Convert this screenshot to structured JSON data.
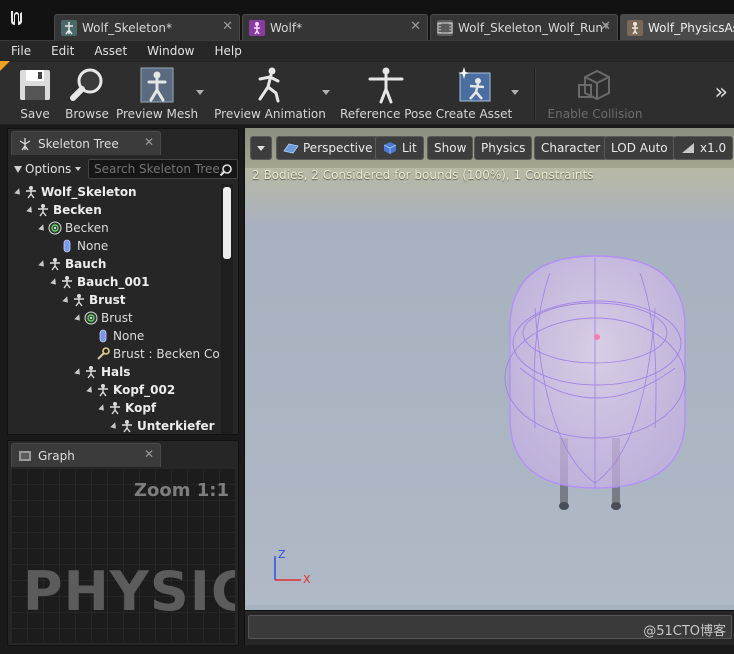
{
  "doc_tabs": [
    {
      "label": "Wolf_Skeleton*",
      "icon": "skeleton-asset-icon",
      "color": "#4a6a6a"
    },
    {
      "label": "Wolf*",
      "icon": "skeletal-mesh-icon",
      "color": "#8a3aa0"
    },
    {
      "label": "Wolf_Skeleton_Wolf_Run*",
      "icon": "animation-sequence-icon",
      "color": "#7a7a7a"
    },
    {
      "label": "Wolf_PhysicsAs",
      "icon": "physics-asset-icon",
      "color": "#7a6a5a"
    }
  ],
  "menu": [
    "File",
    "Edit",
    "Asset",
    "Window",
    "Help"
  ],
  "toolbar": {
    "save": "Save",
    "browse": "Browse",
    "preview_mesh": "Preview Mesh",
    "preview_animation": "Preview Animation",
    "reference_pose": "Reference Pose",
    "create_asset": "Create Asset",
    "enable_collision": "Enable Collision",
    "more": "»"
  },
  "skeleton_panel": {
    "tab": "Skeleton Tree",
    "options": "Options",
    "search_placeholder": "Search Skeleton Tree..."
  },
  "tree": [
    {
      "label": "Wolf_Skeleton",
      "type": "bone",
      "depth": 0,
      "bold": true
    },
    {
      "label": "Becken",
      "type": "bone",
      "depth": 1,
      "bold": true
    },
    {
      "label": "Becken",
      "type": "body",
      "depth": 2,
      "bold": false
    },
    {
      "label": "None",
      "type": "shape",
      "depth": 3,
      "bold": false
    },
    {
      "label": "Bauch",
      "type": "bone",
      "depth": 2,
      "bold": true
    },
    {
      "label": "Bauch_001",
      "type": "bone",
      "depth": 3,
      "bold": true
    },
    {
      "label": "Brust",
      "type": "bone",
      "depth": 4,
      "bold": true
    },
    {
      "label": "Brust",
      "type": "body",
      "depth": 5,
      "bold": false
    },
    {
      "label": "None",
      "type": "shape",
      "depth": 6,
      "bold": false
    },
    {
      "label": "Brust : Becken Cons",
      "type": "constraint",
      "depth": 6,
      "bold": false
    },
    {
      "label": "Hals",
      "type": "bone",
      "depth": 5,
      "bold": true
    },
    {
      "label": "Kopf_002",
      "type": "bone",
      "depth": 6,
      "bold": true
    },
    {
      "label": "Kopf",
      "type": "bone",
      "depth": 7,
      "bold": true
    },
    {
      "label": "Unterkiefer",
      "type": "bone",
      "depth": 8,
      "bold": true
    }
  ],
  "graph_panel": {
    "tab": "Graph",
    "zoom": "Zoom 1:1",
    "watermark": "PHYSIC"
  },
  "viewport": {
    "perspective": "Perspective",
    "lit": "Lit",
    "show": "Show",
    "physics": "Physics",
    "character": "Character",
    "lod": "LOD Auto",
    "speed": "x1.0",
    "status": "2 Bodies, 2 Considered for bounds (100%), 1 Constraints",
    "axis_z": "Z",
    "axis_x": "X"
  },
  "watermark": "@51CTO博客",
  "colors": {
    "body_selection": "#b48cff",
    "axis_x": "#e03030",
    "axis_z": "#3050e0",
    "accent": "#f0a020"
  }
}
